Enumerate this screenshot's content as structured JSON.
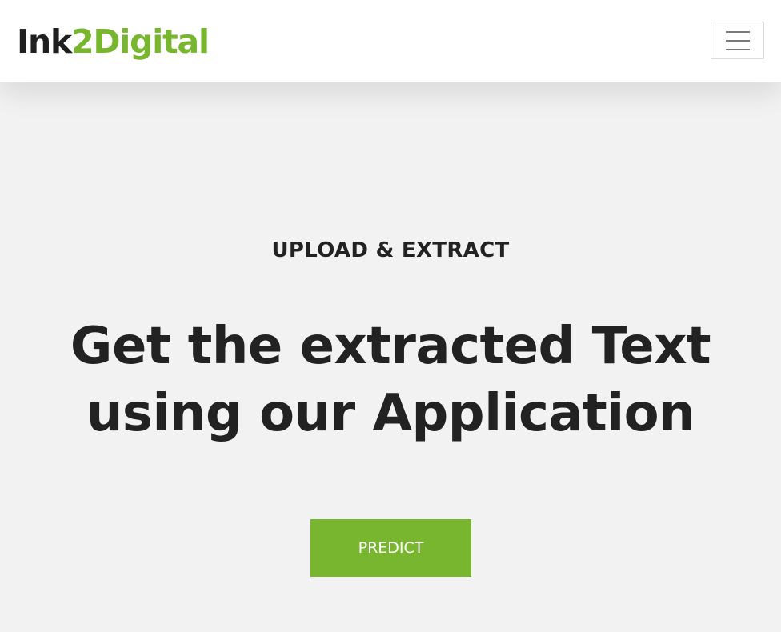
{
  "header": {
    "brand_prefix": "Ink",
    "brand_accent": "2Digital",
    "menu_icon": "hamburger-menu-icon"
  },
  "hero": {
    "eyebrow": "UPLOAD & EXTRACT",
    "headline_line1": "Get the extracted Text",
    "headline_line2": "using our Application",
    "predict_label": "PREDICT"
  },
  "colors": {
    "accent": "#79b62f",
    "text_dark": "#222222",
    "background": "#f2f2f2",
    "header_background": "#ffffff"
  }
}
